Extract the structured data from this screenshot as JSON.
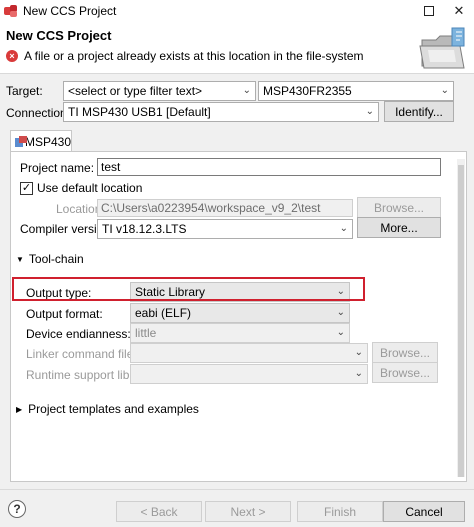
{
  "window": {
    "title": "New CCS Project",
    "close_glyph": "✕"
  },
  "header": {
    "title": "New CCS Project",
    "error_message": "A file or a project already exists at this location in the file-system",
    "error_glyph": "×"
  },
  "target": {
    "label": "Target:",
    "filter_value": "<select or type filter text>",
    "device_value": "MSP430FR2355"
  },
  "connection": {
    "label": "Connection:",
    "value": "TI MSP430 USB1 [Default]",
    "identify_label": "Identify..."
  },
  "tab": {
    "label": "MSP430"
  },
  "project": {
    "name_label": "Project name:",
    "name_value": "test",
    "use_default_label": "Use default location",
    "use_default_checked": true,
    "location_label": "Location:",
    "location_value": "C:\\Users\\a0223954\\workspace_v9_2\\test",
    "browse_label": "Browse...",
    "compiler_label": "Compiler version:",
    "compiler_value": "TI v18.12.3.LTS",
    "more_label": "More..."
  },
  "toolchain": {
    "section_label": "Tool-chain",
    "output_type_label": "Output type:",
    "output_type_value": "Static Library",
    "output_format_label": "Output format:",
    "output_format_value": "eabi (ELF)",
    "endianness_label": "Device endianness:",
    "endianness_value": "little",
    "linker_cmd_label": "Linker command file:",
    "linker_browse_label": "Browse...",
    "runtime_label": "Runtime support library:",
    "runtime_browse_label": "Browse..."
  },
  "templates": {
    "section_label": "Project templates and examples"
  },
  "footer": {
    "help_glyph": "?",
    "back_label": "< Back",
    "next_label": "Next >",
    "finish_label": "Finish",
    "cancel_label": "Cancel"
  },
  "colors": {
    "highlight": "#d0202e",
    "error": "#d93a3a"
  }
}
